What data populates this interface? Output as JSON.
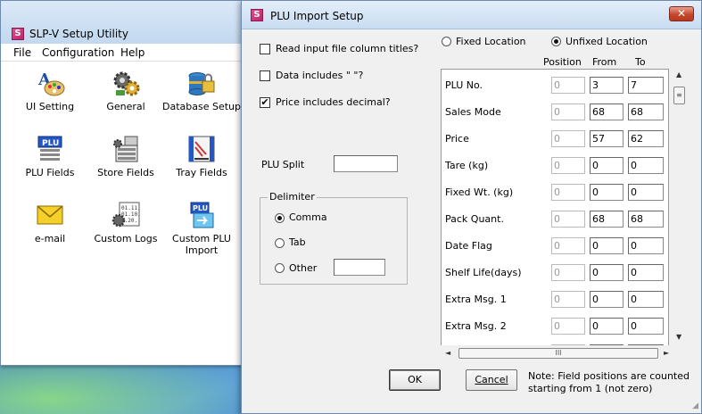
{
  "back_window": {
    "title": "SLP-V Setup Utility",
    "menu": [
      "File",
      "Configuration",
      "Help"
    ],
    "tiles": [
      {
        "label": "UI Setting",
        "icon": "ui-setting-icon"
      },
      {
        "label": "General",
        "icon": "general-gear-icon"
      },
      {
        "label": "Database Setup",
        "icon": "database-lock-icon"
      },
      {
        "label": "PLU Fields",
        "icon": "plu-fields-icon"
      },
      {
        "label": "Store Fields",
        "icon": "store-fields-icon"
      },
      {
        "label": "Tray Fields",
        "icon": "tray-fields-icon"
      },
      {
        "label": "e-mail",
        "icon": "envelope-icon"
      },
      {
        "label": "Custom Logs",
        "icon": "custom-logs-icon"
      },
      {
        "label": "Custom PLU Import",
        "icon": "custom-plu-import-icon"
      }
    ]
  },
  "dialog": {
    "title": "PLU Import Setup",
    "close_glyph": "✕",
    "options": {
      "read_titles": {
        "label": "Read input file column titles?",
        "checked": false
      },
      "includes_quote": {
        "label": "Data includes \" \"?",
        "checked": false
      },
      "price_decimal": {
        "label": "Price includes decimal?",
        "checked": true,
        "mark": "✔"
      }
    },
    "plu_split": {
      "label": "PLU Split",
      "value": ""
    },
    "delimiter": {
      "legend": "Delimiter",
      "comma": "Comma",
      "tab": "Tab",
      "other": "Other",
      "other_value": "",
      "selected": "Comma"
    },
    "location": {
      "fixed": "Fixed Location",
      "unfixed": "Unfixed Location",
      "selected": "Unfixed Location"
    },
    "columns": {
      "position": "Position",
      "from": "From",
      "to": "To"
    },
    "rows": [
      {
        "label": "PLU No.",
        "position": "0",
        "from": "3",
        "to": "7"
      },
      {
        "label": "Sales Mode",
        "position": "0",
        "from": "68",
        "to": "68"
      },
      {
        "label": "Price",
        "position": "0",
        "from": "57",
        "to": "62"
      },
      {
        "label": "Tare (kg)",
        "position": "0",
        "from": "0",
        "to": "0"
      },
      {
        "label": "Fixed Wt. (kg)",
        "position": "0",
        "from": "0",
        "to": "0"
      },
      {
        "label": "Pack Quant.",
        "position": "0",
        "from": "68",
        "to": "68"
      },
      {
        "label": "Date Flag",
        "position": "0",
        "from": "0",
        "to": "0"
      },
      {
        "label": "Shelf Life(days)",
        "position": "0",
        "from": "0",
        "to": "0"
      },
      {
        "label": "Extra Msg. 1",
        "position": "0",
        "from": "0",
        "to": "0"
      },
      {
        "label": "Extra Msg. 2",
        "position": "0",
        "from": "0",
        "to": "0"
      }
    ],
    "scroll": {
      "thumb_grip": "≡",
      "h_thumb_grip": "III",
      "up": "▲",
      "down": "▼",
      "left": "◄",
      "right": "►"
    },
    "ok_label": "OK",
    "cancel_label": "Cancel",
    "note_line1": "Note: Field positions are counted",
    "note_line2": "starting from 1 (not zero)"
  }
}
